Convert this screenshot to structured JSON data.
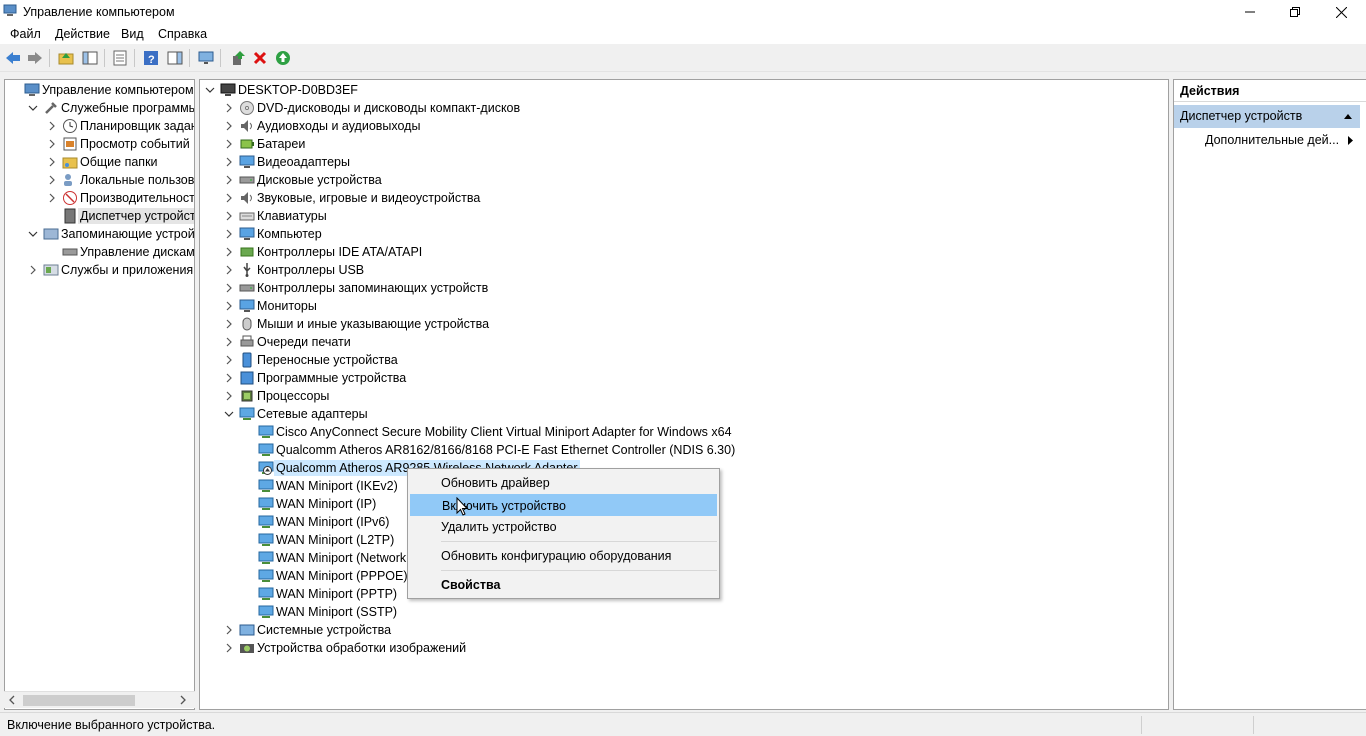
{
  "window": {
    "title": "Управление компьютером"
  },
  "menu": [
    "Файл",
    "Действие",
    "Вид",
    "Справка"
  ],
  "left_tree": [
    {
      "label": "Управление компьютером (л",
      "icon": "computer-management-icon",
      "level": 0,
      "expander": "none"
    },
    {
      "label": "Служебные программы",
      "icon": "tools-icon",
      "level": 1,
      "expander": "expanded"
    },
    {
      "label": "Планировщик заданий",
      "icon": "clock-icon",
      "level": 2,
      "expander": "collapsed"
    },
    {
      "label": "Просмотр событий",
      "icon": "event-viewer-icon",
      "level": 2,
      "expander": "collapsed"
    },
    {
      "label": "Общие папки",
      "icon": "shared-folder-icon",
      "level": 2,
      "expander": "collapsed"
    },
    {
      "label": "Локальные пользовате",
      "icon": "users-icon",
      "level": 2,
      "expander": "collapsed"
    },
    {
      "label": "Производительность",
      "icon": "performance-icon",
      "level": 2,
      "expander": "collapsed"
    },
    {
      "label": "Диспетчер устройств",
      "icon": "device-manager-icon",
      "level": 2,
      "expander": "none",
      "selected": true
    },
    {
      "label": "Запоминающие устройст",
      "icon": "storage-icon",
      "level": 1,
      "expander": "expanded"
    },
    {
      "label": "Управление дисками",
      "icon": "disk-management-icon",
      "level": 2,
      "expander": "none"
    },
    {
      "label": "Службы и приложения",
      "icon": "services-icon",
      "level": 1,
      "expander": "collapsed"
    }
  ],
  "device_tree": {
    "root": "DESKTOP-D0BD3EF",
    "categories_before": [
      {
        "label": "DVD-дисководы и дисководы компакт-дисков",
        "icon": "dvd-icon"
      },
      {
        "label": "Аудиовходы и аудиовыходы",
        "icon": "speaker-icon"
      },
      {
        "label": "Батареи",
        "icon": "battery-icon"
      },
      {
        "label": "Видеоадаптеры",
        "icon": "display-adapter-icon"
      },
      {
        "label": "Дисковые устройства",
        "icon": "disk-drive-icon"
      },
      {
        "label": "Звуковые, игровые и видеоустройства",
        "icon": "sound-icon"
      },
      {
        "label": "Клавиатуры",
        "icon": "keyboard-icon"
      },
      {
        "label": "Компьютер",
        "icon": "computer-icon"
      },
      {
        "label": "Контроллеры IDE ATA/ATAPI",
        "icon": "ide-controller-icon"
      },
      {
        "label": "Контроллеры USB",
        "icon": "usb-icon"
      },
      {
        "label": "Контроллеры запоминающих устройств",
        "icon": "storage-controller-icon"
      },
      {
        "label": "Мониторы",
        "icon": "monitor-icon"
      },
      {
        "label": "Мыши и иные указывающие устройства",
        "icon": "mouse-icon"
      },
      {
        "label": "Очереди печати",
        "icon": "printer-icon"
      },
      {
        "label": "Переносные устройства",
        "icon": "portable-device-icon"
      },
      {
        "label": "Программные устройства",
        "icon": "software-device-icon"
      },
      {
        "label": "Процессоры",
        "icon": "processor-icon"
      }
    ],
    "network_category": "Сетевые адаптеры",
    "network_adapters": [
      {
        "label": "Cisco AnyConnect Secure Mobility Client Virtual Miniport Adapter for Windows x64"
      },
      {
        "label": "Qualcomm Atheros AR8162/8166/8168 PCI-E Fast Ethernet Controller (NDIS 6.30)"
      },
      {
        "label": "Qualcomm Atheros AR9285 Wireless Network Adapter",
        "selected": true,
        "disabled_badge": true
      },
      {
        "label": "WAN Miniport (IKEv2)"
      },
      {
        "label": "WAN Miniport (IP)"
      },
      {
        "label": "WAN Miniport (IPv6)"
      },
      {
        "label": "WAN Miniport (L2TP)"
      },
      {
        "label": "WAN Miniport (Network Monitor)"
      },
      {
        "label": "WAN Miniport (PPPOE)"
      },
      {
        "label": "WAN Miniport (PPTP)"
      },
      {
        "label": "WAN Miniport (SSTP)"
      }
    ],
    "categories_after": [
      {
        "label": "Системные устройства",
        "icon": "system-device-icon"
      },
      {
        "label": "Устройства обработки изображений",
        "icon": "imaging-device-icon"
      }
    ]
  },
  "context_menu": {
    "items": [
      "Обновить драйвер",
      "Включить устройство",
      "Удалить устройство"
    ],
    "items2": [
      "Обновить конфигурацию оборудования"
    ],
    "properties": "Свойства",
    "highlighted_index": 1
  },
  "actions": {
    "header": "Действия",
    "section": "Диспетчер устройств",
    "more": "Дополнительные дей..."
  },
  "status": {
    "text": "Включение выбранного устройства."
  },
  "colors": {
    "selection": "#cce8ff",
    "menu_highlight": "#91c9f7",
    "actions_section": "#b9d1ea"
  }
}
